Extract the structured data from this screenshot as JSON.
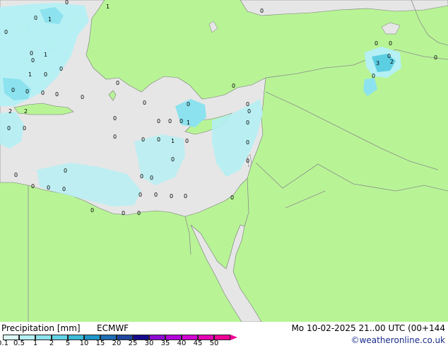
{
  "footer": {
    "title": "Precipitation [mm]",
    "model": "ECMWF",
    "datetime": "Mo 10-02-2025 21..00 UTC (00+144",
    "credit": "©weatheronline.co.uk"
  },
  "legend": {
    "ticks": [
      "0.1",
      "0.5",
      "1",
      "2",
      "5",
      "10",
      "15",
      "20",
      "25",
      "30",
      "35",
      "40",
      "45",
      "50"
    ],
    "colors": [
      "#ddfafa",
      "#b4f0f4",
      "#8ce2ee",
      "#64d2e6",
      "#3cbad8",
      "#1e96c8",
      "#1e6eb4",
      "#1e46a0",
      "#140a8c",
      "#8c0ad2",
      "#b400dc",
      "#d200d2",
      "#e600b4",
      "#f00096"
    ]
  },
  "colors": {
    "land": "#b8f496",
    "sea": "#e6e6e6",
    "precip_light": "#b4f0f4",
    "precip_mid": "#8ce2ee",
    "precip_strong": "#5ccee2",
    "border": "#8c8c8c"
  },
  "map_labels": [
    "0",
    "1",
    "1",
    "2",
    "0",
    "0",
    "0",
    "0",
    "1",
    "0",
    "1",
    "2",
    "0",
    "0",
    "0",
    "0",
    "0",
    "0",
    "0",
    "0",
    "0",
    "0",
    "0",
    "0",
    "0",
    "1",
    "0",
    "0",
    "0",
    "0",
    "0",
    "0",
    "0",
    "0",
    "0",
    "0",
    "1",
    "0",
    "0",
    "0",
    "0",
    "0",
    "0",
    "0",
    "0",
    "0",
    "0",
    "0",
    "0",
    "0",
    "0",
    "0",
    "0",
    "0",
    "0",
    "0",
    "0",
    "3",
    "2",
    "0",
    "0",
    "0",
    "0"
  ]
}
